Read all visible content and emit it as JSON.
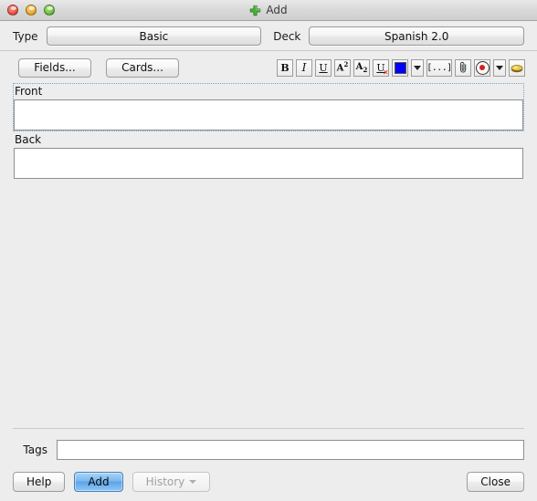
{
  "window": {
    "title": "Add",
    "title_icon": "green-plus-icon",
    "controls": {
      "close": "close-window-button",
      "minimize": "minimize-window-button",
      "zoom": "zoom-window-button"
    }
  },
  "notetype_row": {
    "type_label": "Type",
    "type_value": "Basic",
    "deck_label": "Deck",
    "deck_value": "Spanish 2.0"
  },
  "toolbar": {
    "fields_button": "Fields...",
    "cards_button": "Cards...",
    "format_buttons": [
      {
        "name": "bold-button",
        "label": "B"
      },
      {
        "name": "italic-button",
        "label": "I"
      },
      {
        "name": "underline-button",
        "label": "U"
      },
      {
        "name": "superscript-button",
        "label": "A2"
      },
      {
        "name": "subscript-button",
        "label": "A2"
      },
      {
        "name": "clear-formatting-button",
        "label": "U"
      },
      {
        "name": "text-color-button",
        "label": ""
      },
      {
        "name": "text-color-dropdown-button",
        "label": ""
      },
      {
        "name": "cloze-button",
        "label": "[...]"
      },
      {
        "name": "attach-media-button",
        "label": ""
      },
      {
        "name": "record-audio-button",
        "label": ""
      },
      {
        "name": "advanced-dropdown-button",
        "label": ""
      },
      {
        "name": "equations-button",
        "label": ""
      }
    ],
    "text_color": "#0000ff"
  },
  "editor": {
    "fields": [
      {
        "name": "Front",
        "value": "",
        "focused": true
      },
      {
        "name": "Back",
        "value": "",
        "focused": false
      }
    ]
  },
  "tags": {
    "label": "Tags",
    "value": "",
    "placeholder": ""
  },
  "footer": {
    "help_button": "Help",
    "add_button": "Add",
    "history_button": "History",
    "history_enabled": false,
    "close_button": "Close"
  },
  "colors": {
    "window_background": "#ededed",
    "accent_button": "#5aa4e8",
    "field_background": "#ffffff",
    "focus_outline": "#7f9fc4"
  }
}
